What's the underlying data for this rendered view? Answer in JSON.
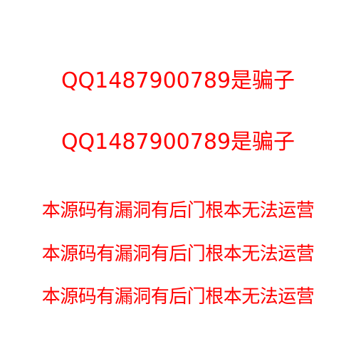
{
  "text_color": "#ff0000",
  "lines": [
    "QQ1487900789是骗子",
    "QQ1487900789是骗子",
    "本源码有漏洞有后门根本无法运营",
    "本源码有漏洞有后门根本无法运营",
    "本源码有漏洞有后门根本无法运营"
  ]
}
